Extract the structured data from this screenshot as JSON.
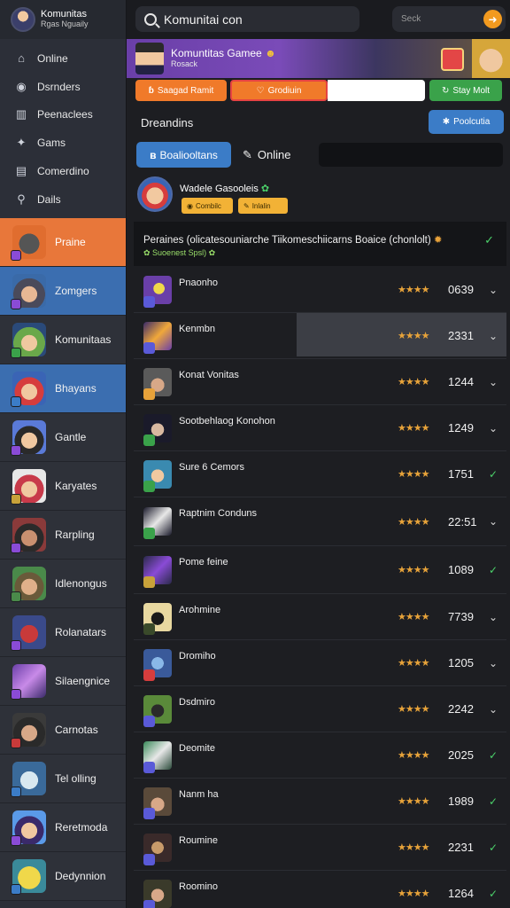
{
  "profile": {
    "name": "Komunitas",
    "sub": "Rgas Nguaily"
  },
  "nav": [
    {
      "label": "Online",
      "icon": "home-icon"
    },
    {
      "label": "Dsrnders",
      "icon": "avatar-icon"
    },
    {
      "label": "Peenaclees",
      "icon": "grid-icon"
    },
    {
      "label": "Gams",
      "icon": "gamepad-icon"
    },
    {
      "label": "Comerdino",
      "icon": "chat-icon"
    },
    {
      "label": "Dails",
      "icon": "search-icon"
    }
  ],
  "games": [
    {
      "label": "Praine"
    },
    {
      "label": "Zomgers"
    },
    {
      "label": "Komunitaas"
    },
    {
      "label": "Bhayans"
    },
    {
      "label": "Gantle"
    },
    {
      "label": "Karyates"
    },
    {
      "label": "Rarpling"
    },
    {
      "label": "Idlenongus"
    },
    {
      "label": "Rolanatars"
    },
    {
      "label": "Silaengnice"
    },
    {
      "label": "Carnotas"
    },
    {
      "label": "Tel olling"
    },
    {
      "label": "Reretmoda"
    },
    {
      "label": "Dedynnion"
    }
  ],
  "topbar": {
    "search_value": "Komunitai con",
    "search2_placeholder": "Seck"
  },
  "banner": {
    "title": "Komuntitas Gamee",
    "sub": "Rosack"
  },
  "actions": {
    "orange": "Saagad Ramit",
    "red": "Grodiuin",
    "green": "Stay Molt"
  },
  "section": {
    "title": "Dreandins",
    "button": "Poolcutia"
  },
  "tabs": {
    "active": "Boaliooltans",
    "online": "Online"
  },
  "featured": {
    "name": "Wadele Gasooleis",
    "chip1": "Combilc",
    "chip2": "Inlalin"
  },
  "panel": {
    "title": "Peraines (olicatesouniarche Tiikomeschiicarns Boaice (chonlolt)",
    "sub": "Suoenest Spsl)"
  },
  "rows": [
    {
      "name": "Pnaonho",
      "stars": "★★★★",
      "score": "0639"
    },
    {
      "name": "Kenmbn",
      "stars": "★★★★",
      "score": "2331"
    },
    {
      "name": "Konat Vonitas",
      "stars": "★★★★",
      "score": "1244"
    },
    {
      "name": "Sootbehlaog Konohon",
      "stars": "★★★★",
      "score": "1249"
    },
    {
      "name": "Sure 6 Cemors",
      "stars": "★★★★",
      "score": "1751"
    },
    {
      "name": "Raptnim Conduns",
      "stars": "★★★★",
      "score": "22:51"
    },
    {
      "name": "Pome feine",
      "stars": "★★★★",
      "score": "1089"
    },
    {
      "name": "Arohmine",
      "stars": "★★★★",
      "score": "7739"
    },
    {
      "name": "Dromiho",
      "stars": "★★★★",
      "score": "1205"
    },
    {
      "name": "Dsdmiro",
      "stars": "★★★★",
      "score": "2242"
    },
    {
      "name": "Deomite",
      "stars": "★★★★",
      "score": "2025"
    },
    {
      "name": "Nanm ha",
      "stars": "★★★★",
      "score": "1989"
    },
    {
      "name": "Roumine",
      "stars": "★★★★",
      "score": "2231"
    },
    {
      "name": "Roomino",
      "stars": "★★★★",
      "score": "1264"
    }
  ]
}
